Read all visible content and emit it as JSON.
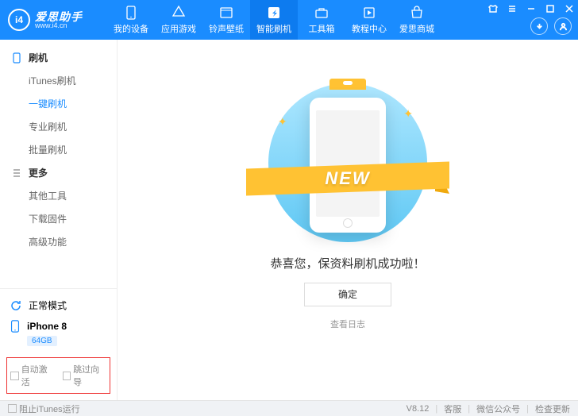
{
  "brand": {
    "icon_text": "i4",
    "name_cn": "爱思助手",
    "name_en": "www.i4.cn"
  },
  "nav": [
    {
      "label": "我的设备",
      "icon": "device"
    },
    {
      "label": "应用游戏",
      "icon": "apps"
    },
    {
      "label": "铃声壁纸",
      "icon": "media"
    },
    {
      "label": "智能刷机",
      "icon": "flash",
      "active": true
    },
    {
      "label": "工具箱",
      "icon": "tools"
    },
    {
      "label": "教程中心",
      "icon": "tutorial"
    },
    {
      "label": "爱思商城",
      "icon": "store"
    }
  ],
  "sidebar": {
    "groups": [
      {
        "title": "刷机",
        "icon": "phone",
        "items": [
          {
            "label": "iTunes刷机"
          },
          {
            "label": "一键刷机",
            "selected": true
          },
          {
            "label": "专业刷机"
          },
          {
            "label": "批量刷机"
          }
        ]
      },
      {
        "title": "更多",
        "icon": "more",
        "items": [
          {
            "label": "其他工具"
          },
          {
            "label": "下载固件"
          },
          {
            "label": "高级功能"
          }
        ]
      }
    ],
    "mode": "正常模式",
    "device": {
      "name": "iPhone 8",
      "storage": "64GB"
    },
    "checkboxes": {
      "auto_activate": "自动激活",
      "skip_wizard": "跳过向导"
    }
  },
  "main": {
    "ribbon": "NEW",
    "message": "恭喜您，保资料刷机成功啦！",
    "ok": "确定",
    "view_log": "查看日志"
  },
  "footer": {
    "block_itunes": "阻止iTunes运行",
    "version": "V8.12",
    "links": [
      "客服",
      "微信公众号",
      "检查更新"
    ]
  }
}
